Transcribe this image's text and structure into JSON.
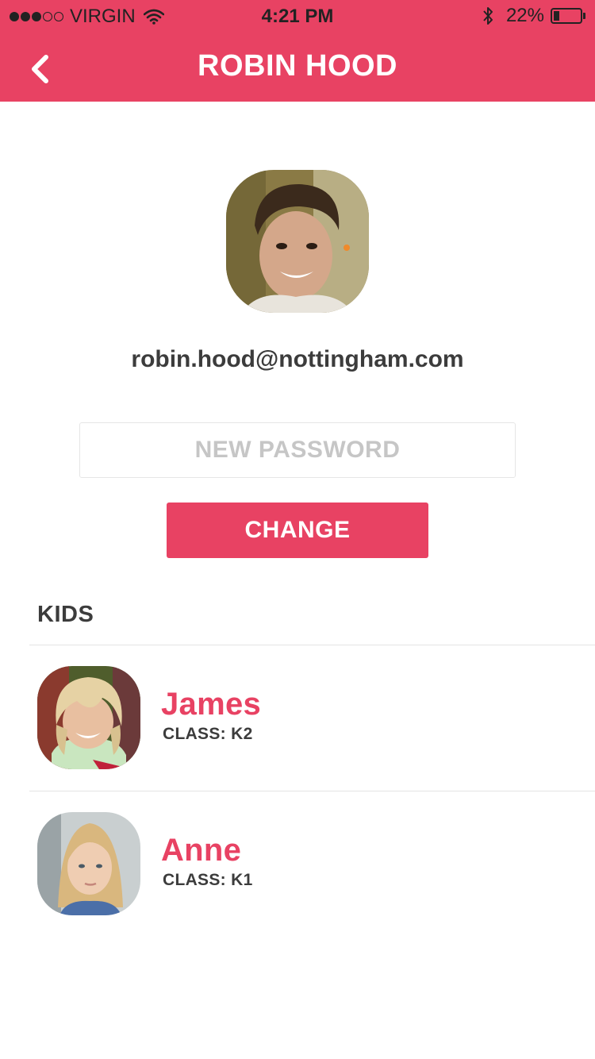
{
  "status_bar": {
    "carrier": "VIRGIN",
    "signal_dots_filled": 3,
    "signal_dots_total": 5,
    "time": "4:21 PM",
    "battery_percent": "22%",
    "battery_level": 0.22,
    "icons": [
      "wifi-icon",
      "bluetooth-icon",
      "battery-icon"
    ]
  },
  "header": {
    "title": "ROBIN HOOD",
    "back_icon": "chevron-left-icon"
  },
  "profile": {
    "email": "robin.hood@nottingham.com",
    "password_placeholder": "NEW PASSWORD",
    "change_label": "CHANGE"
  },
  "kids": {
    "heading": "KIDS",
    "items": [
      {
        "name": "James",
        "class": "CLASS: K2"
      },
      {
        "name": "Anne",
        "class": "CLASS: K1"
      }
    ]
  },
  "colors": {
    "accent": "#e84263",
    "text_dark": "#3c3c3c",
    "placeholder": "#c6c6c6"
  }
}
